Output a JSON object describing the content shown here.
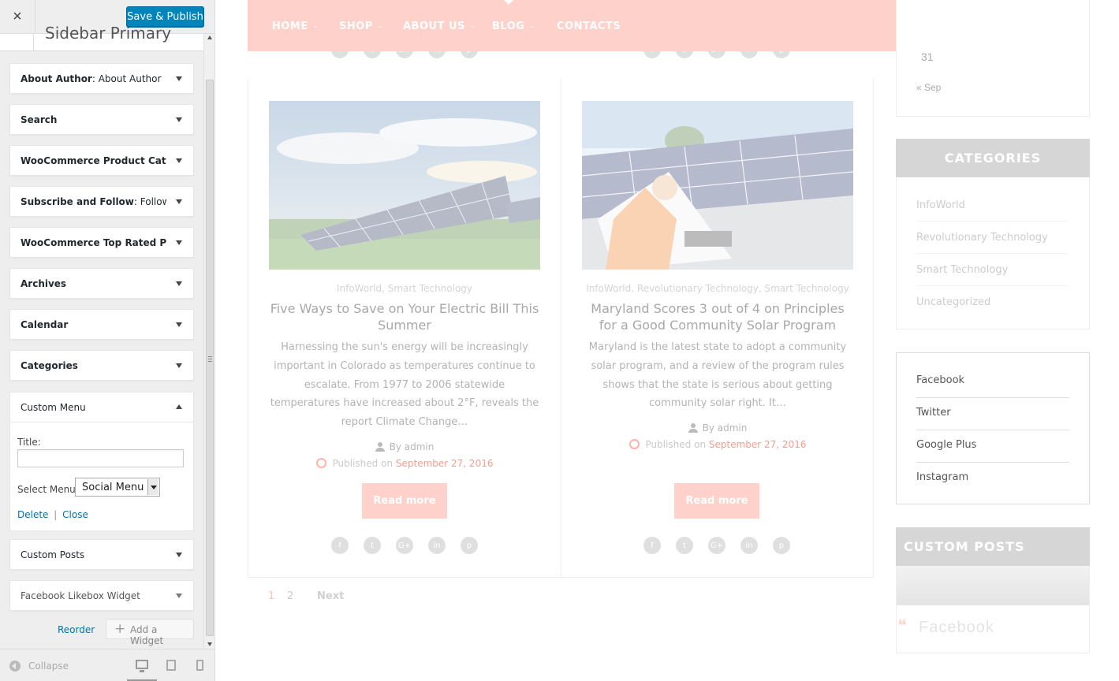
{
  "customizer": {
    "close_label": "×",
    "publish_label": "Save & Publish",
    "section_title": "Sidebar Primary",
    "widgets": [
      {
        "name": "About Author",
        "subtitle": ": About Author"
      },
      {
        "name": "Search",
        "subtitle": ""
      },
      {
        "name": "WooCommerce Product Cate...",
        "subtitle": ""
      },
      {
        "name": "Subscribe and Follow",
        "subtitle": ": Follow..."
      },
      {
        "name": "WooCommerce Top Rated Pr...",
        "subtitle": ""
      },
      {
        "name": "Archives",
        "subtitle": ""
      },
      {
        "name": "Calendar",
        "subtitle": ""
      },
      {
        "name": "Categories",
        "subtitle": ""
      }
    ],
    "custom_menu": {
      "name": "Custom Menu",
      "title_label": "Title:",
      "title_value": "",
      "select_label": "Select Menu:",
      "select_value": "Social Menu",
      "delete_label": "Delete",
      "separator": "|",
      "close_label": "Close"
    },
    "widgets_after": [
      {
        "name": "Custom Posts"
      },
      {
        "name": "Facebook Likebox Widget"
      }
    ],
    "reorder_label": "Reorder",
    "add_widget_label": "Add a Widget",
    "collapse_label": "Collapse"
  },
  "preview": {
    "nav": [
      "HOME",
      "SHOP",
      "ABOUT US",
      "BLOG",
      "CONTACTS"
    ],
    "nav_with_chevron": [
      true,
      true,
      true,
      true,
      false
    ],
    "social_glyphs": [
      "f",
      "t",
      "G+",
      "in",
      "p"
    ],
    "posts": [
      {
        "categories": "InfoWorld, Smart Technology",
        "title": "Five Ways to Save on Your Electric Bill This Summer",
        "excerpt": "Harnessing the sun's energy will be increasingly important in Colorado as temperatures continue to escalate. From 1977 to 2006 statewide temperatures have increased about 2°F, reveals the report Climate Change…",
        "author": "By admin",
        "published_label": "Published on",
        "date": "September 27, 2016",
        "read_more": "Read more"
      },
      {
        "categories": "InfoWorld, Revolutionary Technology, Smart Technology",
        "title": "Maryland Scores 3 out of 4 on Principles for a Good Community Solar Program",
        "excerpt": "Maryland is the latest state to adopt a community solar program, and a review of the program rules shows that the state is serious about getting community solar right. It…",
        "author": "By admin",
        "published_label": "Published on",
        "date": "September 27, 2016",
        "read_more": "Read more"
      }
    ],
    "pagination": {
      "current": "1",
      "next_page": "2",
      "next_label": "Next"
    },
    "calendar": {
      "last_day": "31",
      "prev_link": "« Sep"
    },
    "categories_widget": {
      "title": "CATEGORIES",
      "items": [
        "InfoWorld",
        "Revolutionary Technology",
        "Smart Technology",
        "Uncategorized"
      ]
    },
    "social_menu": [
      "Facebook",
      "Twitter",
      "Google Plus",
      "Instagram"
    ],
    "custom_posts_title": "CUSTOM POSTS",
    "facebook_title": "Facebook",
    "quote_glyph": "❝"
  },
  "colors": {
    "publish": "#0085ba",
    "nav_bg": "#ffd1cb",
    "link": "#0073aa",
    "date": "#ff9a8c"
  }
}
